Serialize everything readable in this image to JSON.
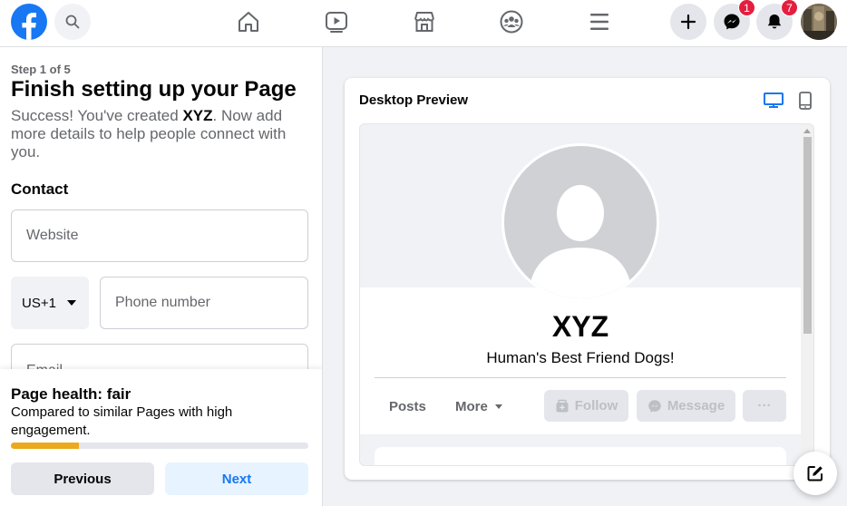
{
  "topbar": {
    "messenger_badge": "1",
    "notifications_badge": "7"
  },
  "setup": {
    "step": "Step 1 of 5",
    "title": "Finish setting up your Page",
    "desc_prefix": "Success! You've created ",
    "desc_page_name": "XYZ",
    "desc_suffix": ". Now add more details to help people connect with you.",
    "section_contact": "Contact",
    "website_placeholder": "Website",
    "country_code": "US+1",
    "phone_placeholder": "Phone number",
    "email_placeholder": "Email"
  },
  "health": {
    "title": "Page health: fair",
    "desc": "Compared to similar Pages with high engagement.",
    "progress_percent": 23,
    "progress_color": "#eba91b"
  },
  "buttons": {
    "previous": "Previous",
    "next": "Next"
  },
  "preview": {
    "title": "Desktop Preview",
    "page_name": "XYZ",
    "category": "Human's Best Friend Dogs!",
    "tabs": [
      "Posts",
      "More"
    ],
    "actions": [
      "Follow",
      "Message",
      "···"
    ]
  },
  "colors": {
    "brand": "#1877f2",
    "badge": "#e41e3f"
  }
}
